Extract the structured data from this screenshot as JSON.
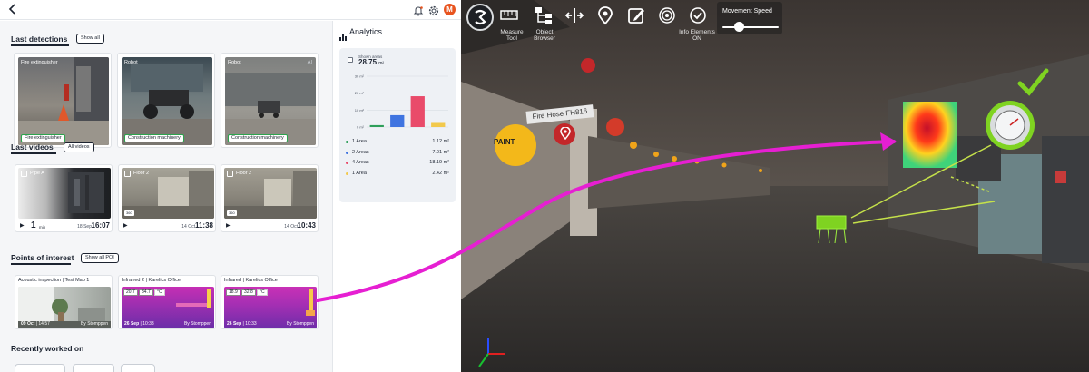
{
  "sections": {
    "detections": {
      "title": "Last detections",
      "show_all": "Show all"
    },
    "videos": {
      "title": "Last videos",
      "show_all": "All videos"
    },
    "poi": {
      "title": "Points of interest",
      "show_all": "Show all POI"
    },
    "recent": {
      "title": "Recently worked on"
    }
  },
  "detections": [
    {
      "label": "Fire extinguisher",
      "tag": "Fire extinguisher"
    },
    {
      "label": "Robot",
      "tag": "Construction machinery"
    },
    {
      "label": "Robot",
      "tag": "Construction machinery",
      "ai": "AI"
    }
  ],
  "videos": [
    {
      "name": "Pipe A",
      "duration": "1",
      "duration_unit": "min",
      "date": "18 Sep",
      "time": "16:07"
    },
    {
      "name": "Floor 2",
      "badge": "360",
      "date": "14 Oct",
      "time": "11:38"
    },
    {
      "name": "Floor 2",
      "badge": "360",
      "date": "14 Oct",
      "time": "10:43"
    }
  ],
  "poi": [
    {
      "title": "Acoustic inspection | Test Map 1",
      "date": "09 Oct",
      "time": "14:57",
      "by": "By Stomppen"
    },
    {
      "title": "Infra red 2 | Karelics Office",
      "temp_low": "20.7",
      "temp_high": "34.7",
      "unit": "°C",
      "date": "26 Sep",
      "time": "10:33",
      "by": "By Stomppen"
    },
    {
      "title": "Infrared | Karelics Office",
      "temp_low": "18.9",
      "temp_high": "32.8",
      "unit": "°C",
      "date": "26 Sep",
      "time": "10:33",
      "by": "By Stomppen"
    }
  ],
  "analytics": {
    "title": "Analytics",
    "subtitle": "Shown areas",
    "total": "28.75",
    "total_unit": "m²",
    "legend": [
      {
        "name": "1 Area",
        "value": "1.12 m²",
        "color": "#2e9f5a"
      },
      {
        "name": "2 Areas",
        "value": "7.01 m²",
        "color": "#3f74e0"
      },
      {
        "name": "4 Areas",
        "value": "18.19 m²",
        "color": "#e94b6a"
      },
      {
        "name": "1 Area",
        "value": "2.42 m²",
        "color": "#f2c94c"
      }
    ]
  },
  "chart_data": {
    "type": "bar",
    "categories": [
      "1 Area",
      "2 Areas",
      "4 Areas",
      "1 Area"
    ],
    "values": [
      1.12,
      7.01,
      18.19,
      2.42
    ],
    "colors": [
      "#2e9f5a",
      "#3f74e0",
      "#e94b6a",
      "#f2c94c"
    ],
    "yticks": [
      "0 m²",
      "10 m²",
      "20 m²",
      "30 m²"
    ],
    "ylim": [
      0,
      30
    ],
    "grid": true,
    "legend_position": "bottom"
  },
  "viewer": {
    "tools": [
      {
        "icon": "ruler-icon",
        "label": "Measure Tool"
      },
      {
        "icon": "hierarchy-icon",
        "label": "Object Browser"
      },
      {
        "icon": "split-arrows-icon",
        "label": ""
      },
      {
        "icon": "map-pin-icon",
        "label": ""
      },
      {
        "icon": "edit-icon",
        "label": ""
      },
      {
        "icon": "target-icon",
        "label": ""
      },
      {
        "icon": "check-circle-icon",
        "label": "Info Elements ON"
      }
    ],
    "speed_label": "Movement Speed",
    "speed_value": 0.3,
    "fire_hose_label": "Fire Hose FH816",
    "paint_label": "PAINT",
    "accent_magenta": "#e61fd2",
    "accent_green": "#7fd321"
  }
}
